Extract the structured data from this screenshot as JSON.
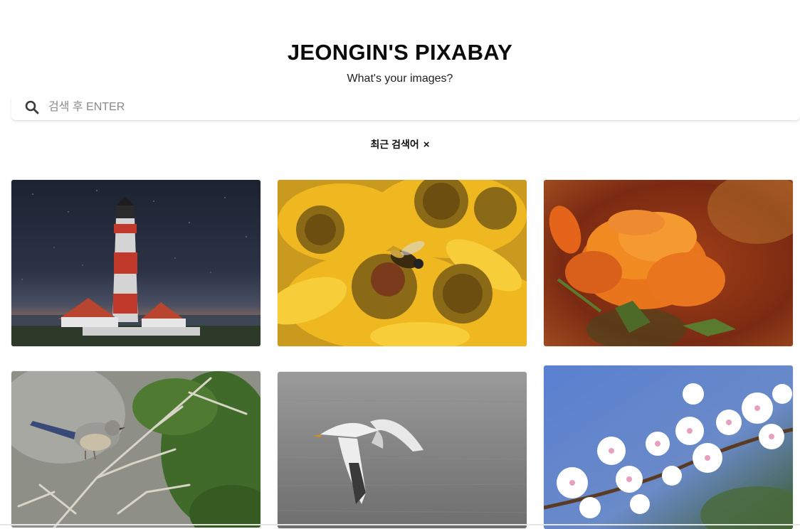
{
  "header": {
    "title": "JEONGIN'S PIXABAY",
    "subtitle": "What's your images?"
  },
  "search": {
    "placeholder": "검색 후 ENTER",
    "icon": "search-icon"
  },
  "recent": {
    "label": "최근 검색어",
    "close": "×"
  },
  "gallery": {
    "images": [
      {
        "subject": "lighthouse"
      },
      {
        "subject": "bee-on-yellow-flowers"
      },
      {
        "subject": "orange-flower"
      },
      {
        "subject": "small-bird-on-branch"
      },
      {
        "subject": "seagull-over-water"
      },
      {
        "subject": "white-blossoms"
      }
    ]
  }
}
